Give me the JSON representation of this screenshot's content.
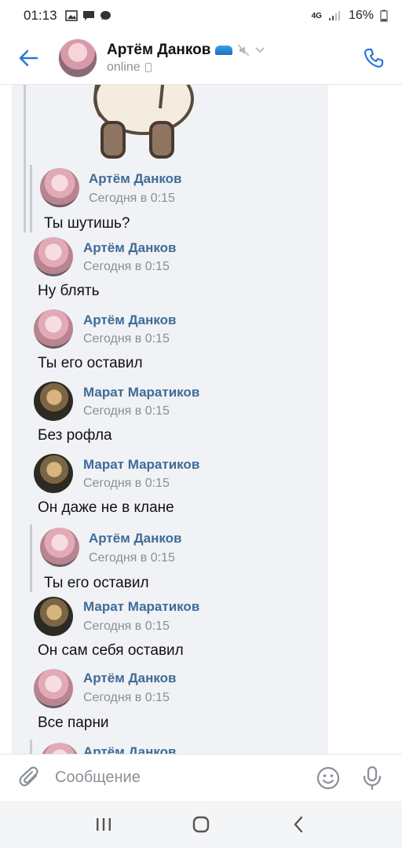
{
  "status_bar": {
    "time": "01:13",
    "network": "4G",
    "battery": "16%"
  },
  "header": {
    "contact_name": "Артём Данков",
    "status": "online"
  },
  "messages": [
    {
      "author": "Артём Данков",
      "time": "Сегодня в 0:15",
      "text": "Ты шутишь?",
      "avatar": "artem",
      "quoted": true
    },
    {
      "author": "Артём Данков",
      "time": "Сегодня в 0:15",
      "text": "Ну блять",
      "avatar": "artem",
      "quoted": false
    },
    {
      "author": "Артём Данков",
      "time": "Сегодня в 0:15",
      "text": "Ты его оставил",
      "avatar": "artem",
      "quoted": false
    },
    {
      "author": "Марат Маратиков",
      "time": "Сегодня в 0:15",
      "text": "Без рофла",
      "avatar": "marat",
      "quoted": false
    },
    {
      "author": "Марат Маратиков",
      "time": "Сегодня в 0:15",
      "text": "Он даже не в клане",
      "avatar": "marat",
      "quoted": false
    },
    {
      "author": "Артём Данков",
      "time": "Сегодня в 0:15",
      "text": "Ты его оставил",
      "avatar": "artem",
      "quoted": true
    },
    {
      "author": "Марат Маратиков",
      "time": "Сегодня в 0:15",
      "text": "Он сам себя оставил",
      "avatar": "marat",
      "quoted": false
    },
    {
      "author": "Артём Данков",
      "time": "Сегодня в 0:15",
      "text": "Все парни",
      "avatar": "artem",
      "quoted": false
    },
    {
      "author": "Артём Данков",
      "time": "",
      "text": "",
      "avatar": "artem",
      "quoted": true
    }
  ],
  "composer": {
    "placeholder": "Сообщение"
  },
  "icons": {
    "back": "arrow-left-icon",
    "call": "phone-icon",
    "mute": "mute-icon",
    "attach": "paperclip-icon",
    "emoji": "smiley-icon",
    "mic": "microphone-icon",
    "scroll_down": "chevron-down-icon"
  },
  "colors": {
    "accent": "#2a77d6",
    "author_name": "#3f6b9a",
    "panel_bg": "#f0f2f5"
  }
}
